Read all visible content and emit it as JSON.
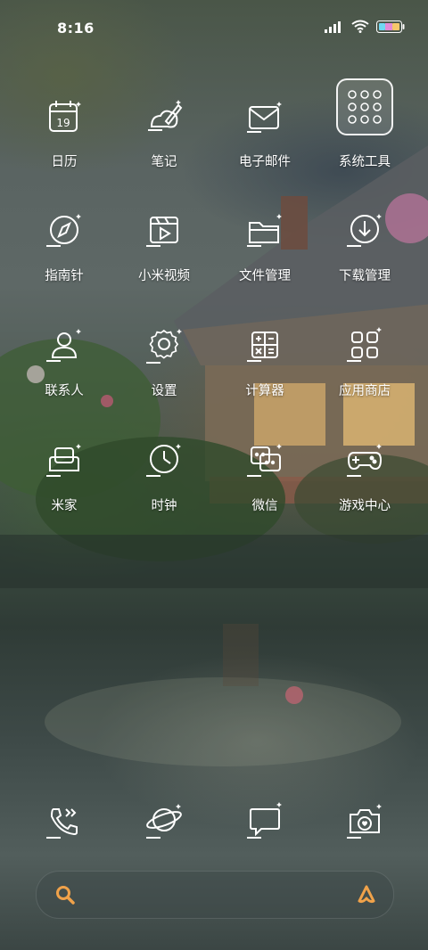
{
  "status_bar": {
    "time": "8:16",
    "signal_icon": "cellular-signal-icon",
    "wifi_icon": "wifi-icon",
    "battery_icon": "battery-icon"
  },
  "apps": [
    {
      "label": "日历",
      "icon": "calendar-icon",
      "calendar_day": "19"
    },
    {
      "label": "笔记",
      "icon": "notes-icon"
    },
    {
      "label": "电子邮件",
      "icon": "email-icon"
    },
    {
      "label": "系统工具",
      "icon": "folder-icon"
    },
    {
      "label": "指南针",
      "icon": "compass-icon"
    },
    {
      "label": "小米视频",
      "icon": "video-icon"
    },
    {
      "label": "文件管理",
      "icon": "file-manager-icon"
    },
    {
      "label": "下载管理",
      "icon": "download-icon"
    },
    {
      "label": "联系人",
      "icon": "contacts-icon"
    },
    {
      "label": "设置",
      "icon": "settings-icon"
    },
    {
      "label": "计算器",
      "icon": "calculator-icon"
    },
    {
      "label": "应用商店",
      "icon": "app-store-icon"
    },
    {
      "label": "米家",
      "icon": "mijia-icon"
    },
    {
      "label": "时钟",
      "icon": "clock-icon"
    },
    {
      "label": "微信",
      "icon": "wechat-icon"
    },
    {
      "label": "游戏中心",
      "icon": "gamepad-icon"
    }
  ],
  "dock": [
    {
      "icon": "phone-icon"
    },
    {
      "icon": "browser-icon"
    },
    {
      "icon": "messages-icon"
    },
    {
      "icon": "camera-icon"
    }
  ],
  "search_bar": {
    "search_icon": "search-icon",
    "assistant_icon": "assistant-icon"
  },
  "colors": {
    "search_accent": "#f0a24a",
    "icon_stroke": "#ffffff"
  }
}
